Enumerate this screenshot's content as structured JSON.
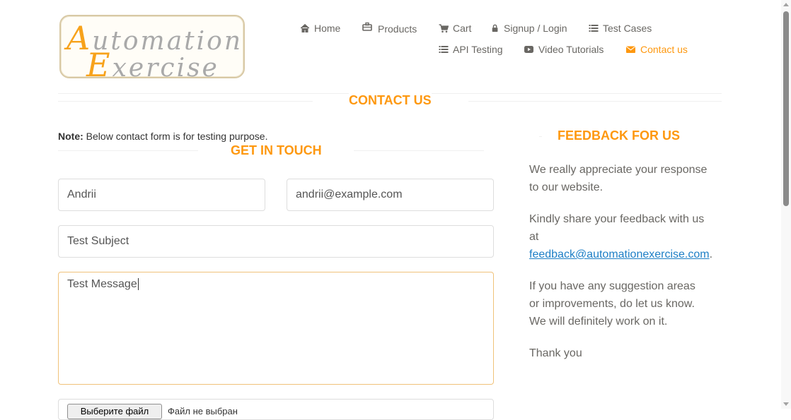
{
  "logo": {
    "line1_cap": "A",
    "line1_rest": "utomation",
    "line2_cap": "E",
    "line2_rest": "xercise"
  },
  "nav": {
    "home": "Home",
    "products": "Products",
    "cart": "Cart",
    "signup_login": "Signup / Login",
    "test_cases": "Test Cases",
    "api_testing": "API Testing",
    "video_tutorials": "Video Tutorials",
    "contact_us": "Contact us"
  },
  "contact": {
    "title": "CONTACT US",
    "note_label": "Note:",
    "note_text": " Below contact form is for testing purpose.",
    "get_in_touch": "GET IN TOUCH",
    "form": {
      "name_value": "Andrii",
      "email_value": "andrii@example.com",
      "subject_value": "Test Subject",
      "message_value": "Test Message",
      "file_button": "Выберите файл",
      "file_status": "Файл не выбран"
    }
  },
  "feedback": {
    "title": "FEEDBACK FOR US",
    "p1": "We really appreciate your response to our website.",
    "p2_text": "Kindly share your feedback with us at",
    "p2_link": "feedback@automationexercise.com",
    "p2_end": ".",
    "p3": "If you have any suggestion areas or improvements, do let us know. We will definitely work on it.",
    "p4": "Thank you"
  },
  "colors": {
    "accent": "#fe980f",
    "link": "#1e7fc6",
    "nav_text": "#696763"
  }
}
